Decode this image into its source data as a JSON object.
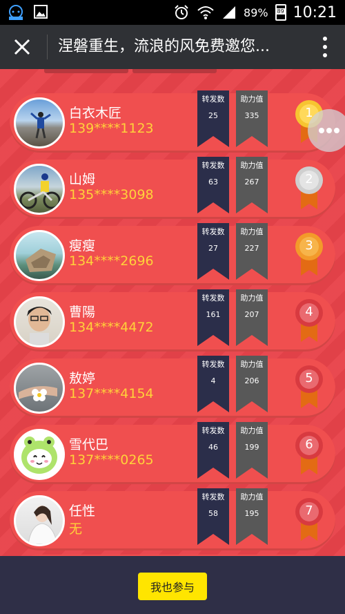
{
  "status_bar": {
    "battery_percent": "89%",
    "battery_level": "89",
    "time": "10:21",
    "icons": [
      "chat-app-icon",
      "image-icon",
      "alarm-icon",
      "wifi-icon",
      "signal-icon",
      "battery-icon"
    ]
  },
  "titlebar": {
    "title": "涅磐重生，流浪的风免费邀您..."
  },
  "rows": [
    {
      "name": "白衣木匠",
      "phone": "139****1123",
      "forward_label": "转发数",
      "forward": "25",
      "help_label": "助力值",
      "help": "335",
      "rank": "1",
      "medal": "gold"
    },
    {
      "name": "山姆",
      "phone": "135****3098",
      "forward_label": "转发数",
      "forward": "63",
      "help_label": "助力值",
      "help": "267",
      "rank": "2",
      "medal": "silver"
    },
    {
      "name": "瘦瘦",
      "phone": "134****2696",
      "forward_label": "转发数",
      "forward": "27",
      "help_label": "助力值",
      "help": "227",
      "rank": "3",
      "medal": "bronze"
    },
    {
      "name": "曹陽",
      "phone": "134****4472",
      "forward_label": "转发数",
      "forward": "161",
      "help_label": "助力值",
      "help": "207",
      "rank": "4",
      "medal": "red"
    },
    {
      "name": "敖婷",
      "phone": "137****4154",
      "forward_label": "转发数",
      "forward": "4",
      "help_label": "助力值",
      "help": "206",
      "rank": "5",
      "medal": "red"
    },
    {
      "name": "雪代巴",
      "phone": "137****0265",
      "forward_label": "转发数",
      "forward": "46",
      "help_label": "助力值",
      "help": "199",
      "rank": "6",
      "medal": "red"
    },
    {
      "name": "任性",
      "phone": "无",
      "forward_label": "转发数",
      "forward": "58",
      "help_label": "助力值",
      "help": "195",
      "rank": "7",
      "medal": "red"
    }
  ],
  "bottom": {
    "join_label": "我也参与"
  },
  "colors": {
    "background": "#e8434a",
    "row": "#f04f4f",
    "ribbon_forward": "#2b2e4a",
    "ribbon_help": "#585858",
    "phone": "#ffd23a",
    "bottom_bar": "#2f2f47",
    "join_button": "#ffe500"
  }
}
